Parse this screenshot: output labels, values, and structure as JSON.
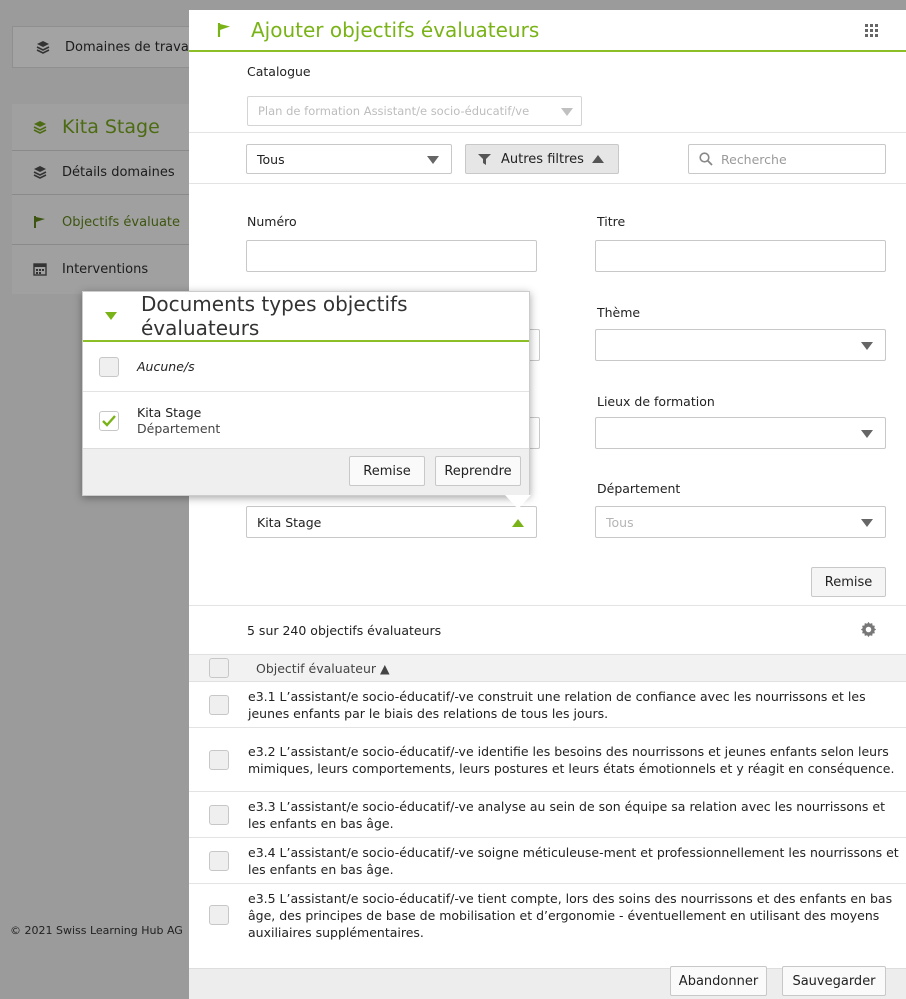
{
  "background": {
    "domain_item": "Domaines de trava",
    "section_title": "Kita Stage",
    "nav_items": [
      {
        "label": "Détails domaines",
        "icon": "layers-icon"
      },
      {
        "label": "Objectifs évaluate",
        "icon": "flag-icon"
      },
      {
        "label": "Interventions",
        "icon": "calendar-icon"
      }
    ],
    "footer_text": "© 2021 Swiss Learning Hub AG"
  },
  "modal": {
    "title": "Ajouter objectifs évaluateurs",
    "catalogue_label": "Catalogue",
    "catalogue_value": "Plan de formation Assistant/e socio-éducatif/ve",
    "scope_select": "Tous",
    "more_filters_label": "Autres filtres",
    "search_placeholder": "Recherche",
    "filters": {
      "numero_label": "Numéro",
      "numero_value": "",
      "titre_label": "Titre",
      "titre_value": "",
      "theme_label": "Thème",
      "lieux_label": "Lieux de formation",
      "departement_label": "Département",
      "departement_value": "Tous",
      "documents_value": "Kita Stage",
      "reset_label": "Remise"
    },
    "count_text": "5 sur 240 objectifs évaluateurs",
    "column_header": "Objectif évaluateur ▲",
    "rows": [
      "e3.1 L’assistant/e socio-éducatif/-ve construit une relation de confiance avec les nourrissons et les jeunes enfants par le biais des relations de tous les jours.",
      "e3.2 L’assistant/e socio-éducatif/-ve identifie les besoins des nourrissons et jeunes enfants selon leurs mimiques, leurs comportements, leurs postures et leurs états émotionnels et y réagit en conséquence.",
      "e3.3 L’assistant/e socio-éducatif/-ve analyse au sein de son équipe sa relation avec les nourrissons et les enfants en bas âge.",
      "e3.4 L’assistant/e socio-éducatif/-ve soigne méticuleuse-ment et professionnellement les nourrissons et les enfants en bas âge.",
      "e3.5 L’assistant/e socio-éducatif/-ve tient compte, lors des soins des nourrissons et des enfants en bas âge, des principes de base de mobilisation et d’ergonomie - éventuellement en utilisant des moyens auxiliaires supplémentaires."
    ],
    "cancel_label": "Abandonner",
    "save_label": "Sauvegarder"
  },
  "popup": {
    "title": "Documents types objectifs évaluateurs",
    "option_none": "Aucune/s",
    "option_selected_name": "Kita Stage",
    "option_selected_sub": "Département",
    "reset_label": "Remise",
    "apply_label": "Reprendre"
  },
  "colors": {
    "accent": "#7ab317",
    "overlay": "#9b9b9b"
  }
}
